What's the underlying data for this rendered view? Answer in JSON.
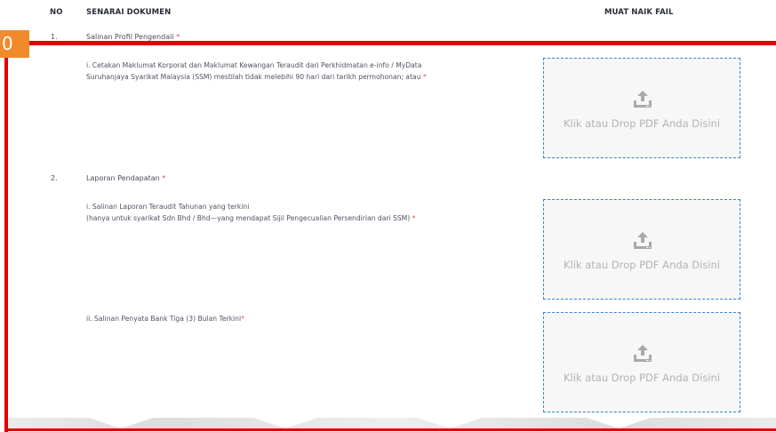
{
  "header": {
    "no": "NO",
    "document_list": "SENARAI DOKUMEN",
    "upload_file": "MUAT NAIK FAIL"
  },
  "overlay": {
    "tag_label": "0",
    "color_line": "#e00000",
    "color_tag": "#f08a2a"
  },
  "items": [
    {
      "no": "1.",
      "title": "Salinan Profil Pengendali",
      "required_mark": "*",
      "subs": [
        {
          "line1": "i. Cetakan Maklumat Korporat dan Maklumat Kewangan Teraudit dari Perkhidmatan e-info / MyData",
          "line2": "Suruhanjaya Syarikat Malaysia (SSM) mestilah tidak melebihi 90 hari dari tarikh permohonan; atau",
          "required_mark": "*",
          "upload_label": "Klik atau Drop PDF Anda Disini",
          "upload_icon": "upload-icon"
        }
      ]
    },
    {
      "no": "2.",
      "title": "Laporan Pendapatan",
      "required_mark": "*",
      "subs": [
        {
          "line1": "i. Salinan Laporan Teraudit Tahunan yang terkini",
          "line2": "(hanya untuk syarikat Sdn Bhd / Bhd—yang mendapat Sijil Pengecualian Persendirian dari SSM)",
          "required_mark": "*",
          "upload_label": "Klik atau Drop PDF Anda Disini",
          "upload_icon": "upload-icon"
        },
        {
          "line1": "ii. Salinan Penyata Bank Tiga (3) Bulan Terkini",
          "required_mark": "*",
          "upload_label": "Klik atau Drop PDF Anda Disini",
          "upload_icon": "upload-icon"
        }
      ]
    }
  ]
}
